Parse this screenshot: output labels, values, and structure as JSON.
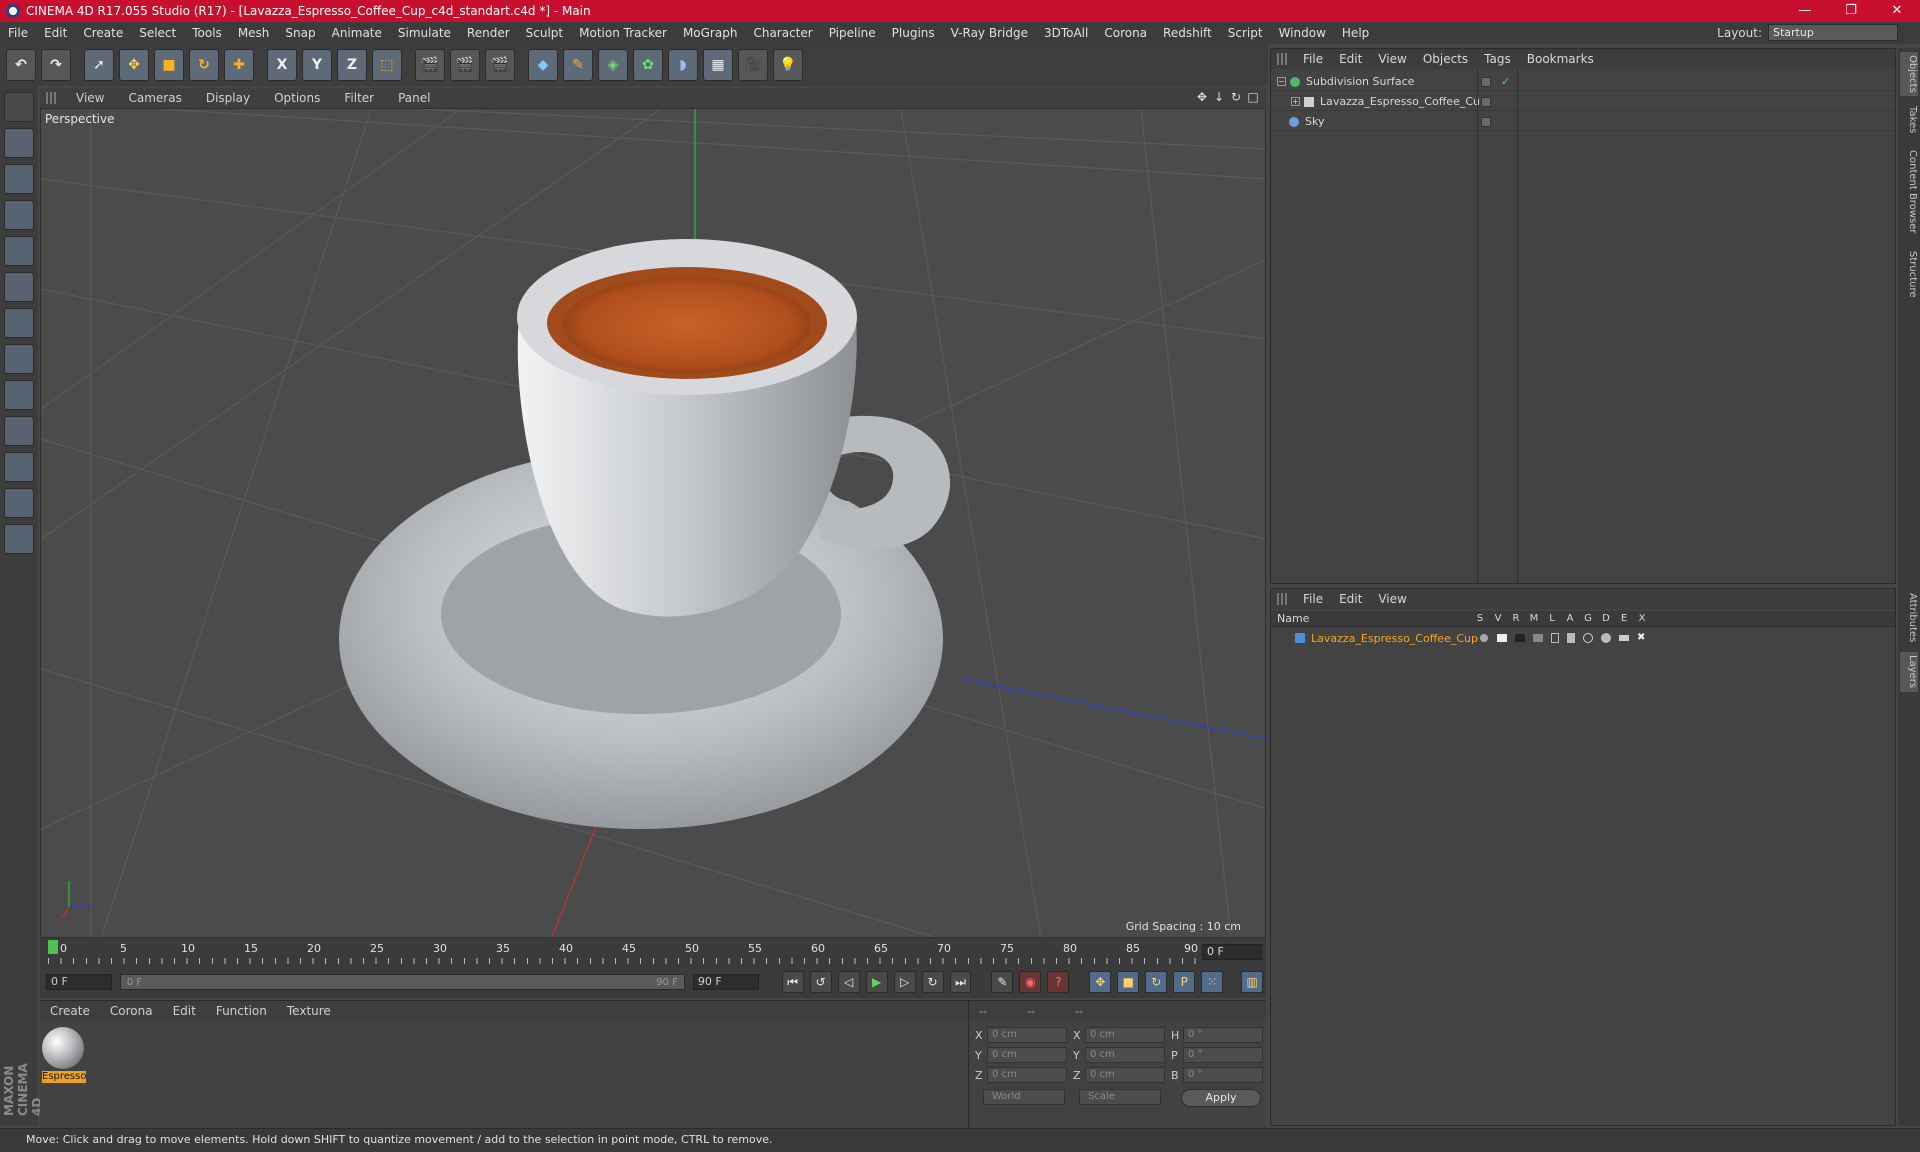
{
  "window": {
    "title": "CINEMA 4D R17.055 Studio (R17) - [Lavazza_Espresso_Coffee_Cup_c4d_standart.c4d *] - Main",
    "minimize": "—",
    "restore": "❐",
    "close": "✕"
  },
  "menubar": {
    "items": [
      "File",
      "Edit",
      "Create",
      "Select",
      "Tools",
      "Mesh",
      "Snap",
      "Animate",
      "Simulate",
      "Render",
      "Sculpt",
      "Motion Tracker",
      "MoGraph",
      "Character",
      "Pipeline",
      "Plugins",
      "V-Ray Bridge",
      "3DToAll",
      "Corona",
      "Redshift",
      "Script",
      "Window",
      "Help"
    ],
    "layout_label": "Layout:",
    "layout_value": "Startup"
  },
  "toolbar": {
    "axis_x": "X",
    "axis_y": "Y",
    "axis_z": "Z"
  },
  "viewport": {
    "menu": [
      "View",
      "Cameras",
      "Display",
      "Options",
      "Filter",
      "Panel"
    ],
    "label": "Perspective",
    "grid_spacing": "Grid Spacing : 10 cm",
    "nav": [
      "✥",
      "↓",
      "↻",
      "□"
    ]
  },
  "timeline": {
    "ticks": [
      "0",
      "5",
      "10",
      "15",
      "20",
      "25",
      "30",
      "35",
      "40",
      "45",
      "50",
      "55",
      "60",
      "65",
      "70",
      "75",
      "80",
      "85",
      "90"
    ],
    "current_frame": "0 F",
    "start_field": "0 F",
    "range_start": "0 F",
    "range_end": "90 F",
    "end_field": "90 F"
  },
  "materials": {
    "menu": [
      "Create",
      "Corona",
      "Edit",
      "Function",
      "Texture"
    ],
    "items": [
      {
        "name": "Espresso"
      }
    ]
  },
  "coordinates": {
    "head": [
      "--",
      "--",
      "--"
    ],
    "rows": [
      {
        "l1": "X",
        "v1": "0 cm",
        "l2": "X",
        "v2": "0 cm",
        "l3": "H",
        "v3": "0 °"
      },
      {
        "l1": "Y",
        "v1": "0 cm",
        "l2": "Y",
        "v2": "0 cm",
        "l3": "P",
        "v3": "0 °"
      },
      {
        "l1": "Z",
        "v1": "0 cm",
        "l2": "Z",
        "v2": "0 cm",
        "l3": "B",
        "v3": "0 °"
      }
    ],
    "world": "World",
    "scale": "Scale",
    "apply": "Apply"
  },
  "objects": {
    "menu": [
      "File",
      "Edit",
      "View",
      "Objects",
      "Tags",
      "Bookmarks"
    ],
    "items": [
      {
        "name": "Subdivision Surface",
        "color": "#4fb86a"
      },
      {
        "name": "Lavazza_Espresso_Coffee_Cup",
        "color": "#cfcfcf"
      },
      {
        "name": "Sky",
        "color": "#6aa0d8"
      }
    ]
  },
  "layers": {
    "menu": [
      "File",
      "Edit",
      "View"
    ],
    "columns": [
      "Name",
      "S",
      "V",
      "R",
      "M",
      "L",
      "A",
      "G",
      "D",
      "E",
      "X"
    ],
    "items": [
      {
        "name": "Lavazza_Espresso_Coffee_Cup",
        "color": "#4a8fd8"
      }
    ]
  },
  "side_tabs": [
    "Objects",
    "Takes",
    "Content Browser",
    "Structure",
    "Attributes",
    "Layers"
  ],
  "status": "Move: Click and drag to move elements. Hold down SHIFT to quantize movement / add to the selection in point mode, CTRL to remove.",
  "brand": "MAXON CINEMA 4D"
}
